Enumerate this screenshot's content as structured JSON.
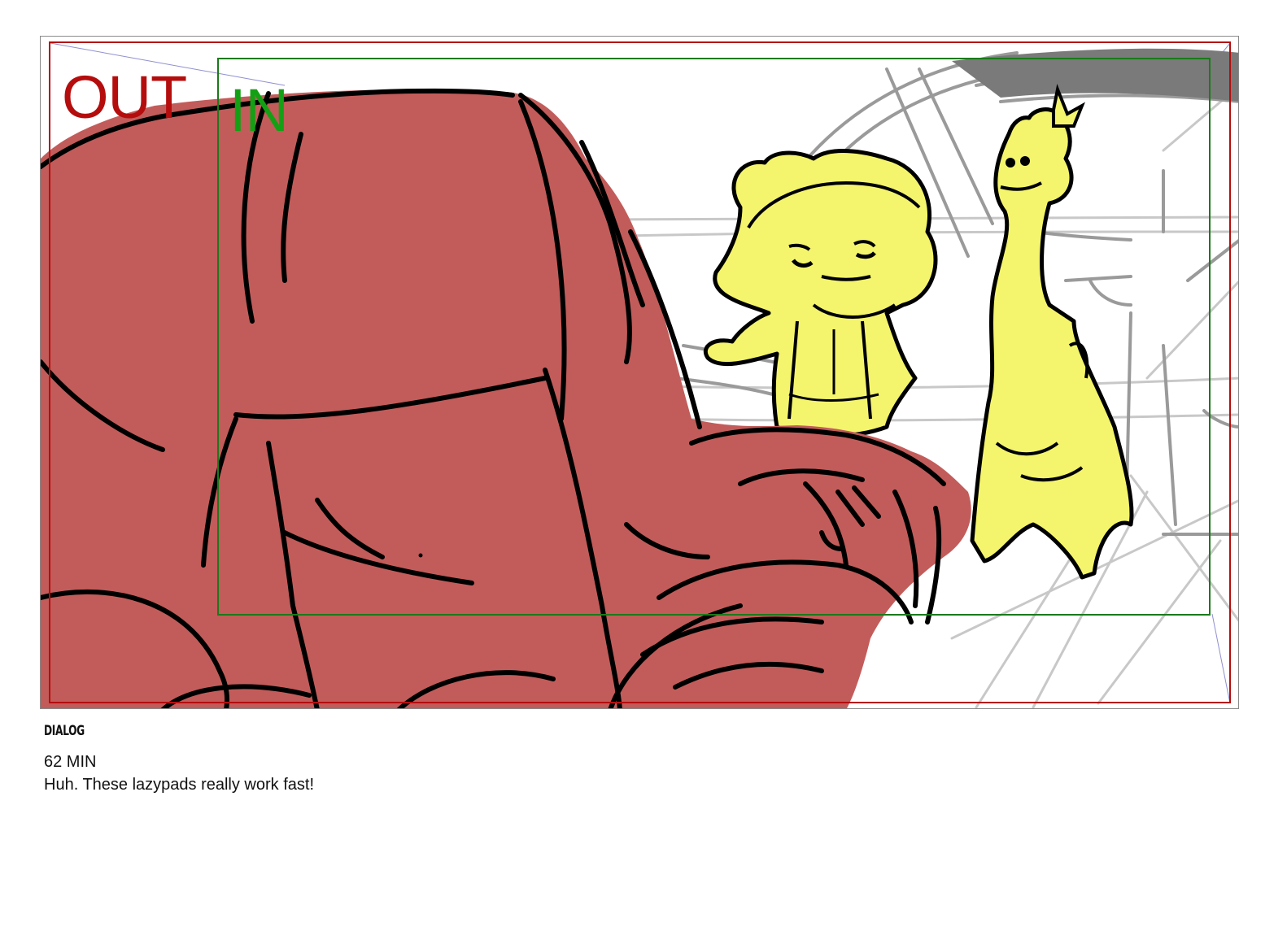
{
  "storyboard_panel": {
    "out_label": "OUT",
    "in_label": "IN",
    "colors": {
      "out_frame": "#b50d0d",
      "in_frame": "#1a7a1a",
      "in_label": "#14a014",
      "foreground_character_fill": "#c25c5a",
      "background_characters_fill": "#f4f56c",
      "line_art": "#000000",
      "background_sketch": "#a9a9a9"
    }
  },
  "dialog": {
    "heading": "DIALOG",
    "duration": "62 MIN",
    "line": "Huh. These lazypads really work fast!"
  }
}
